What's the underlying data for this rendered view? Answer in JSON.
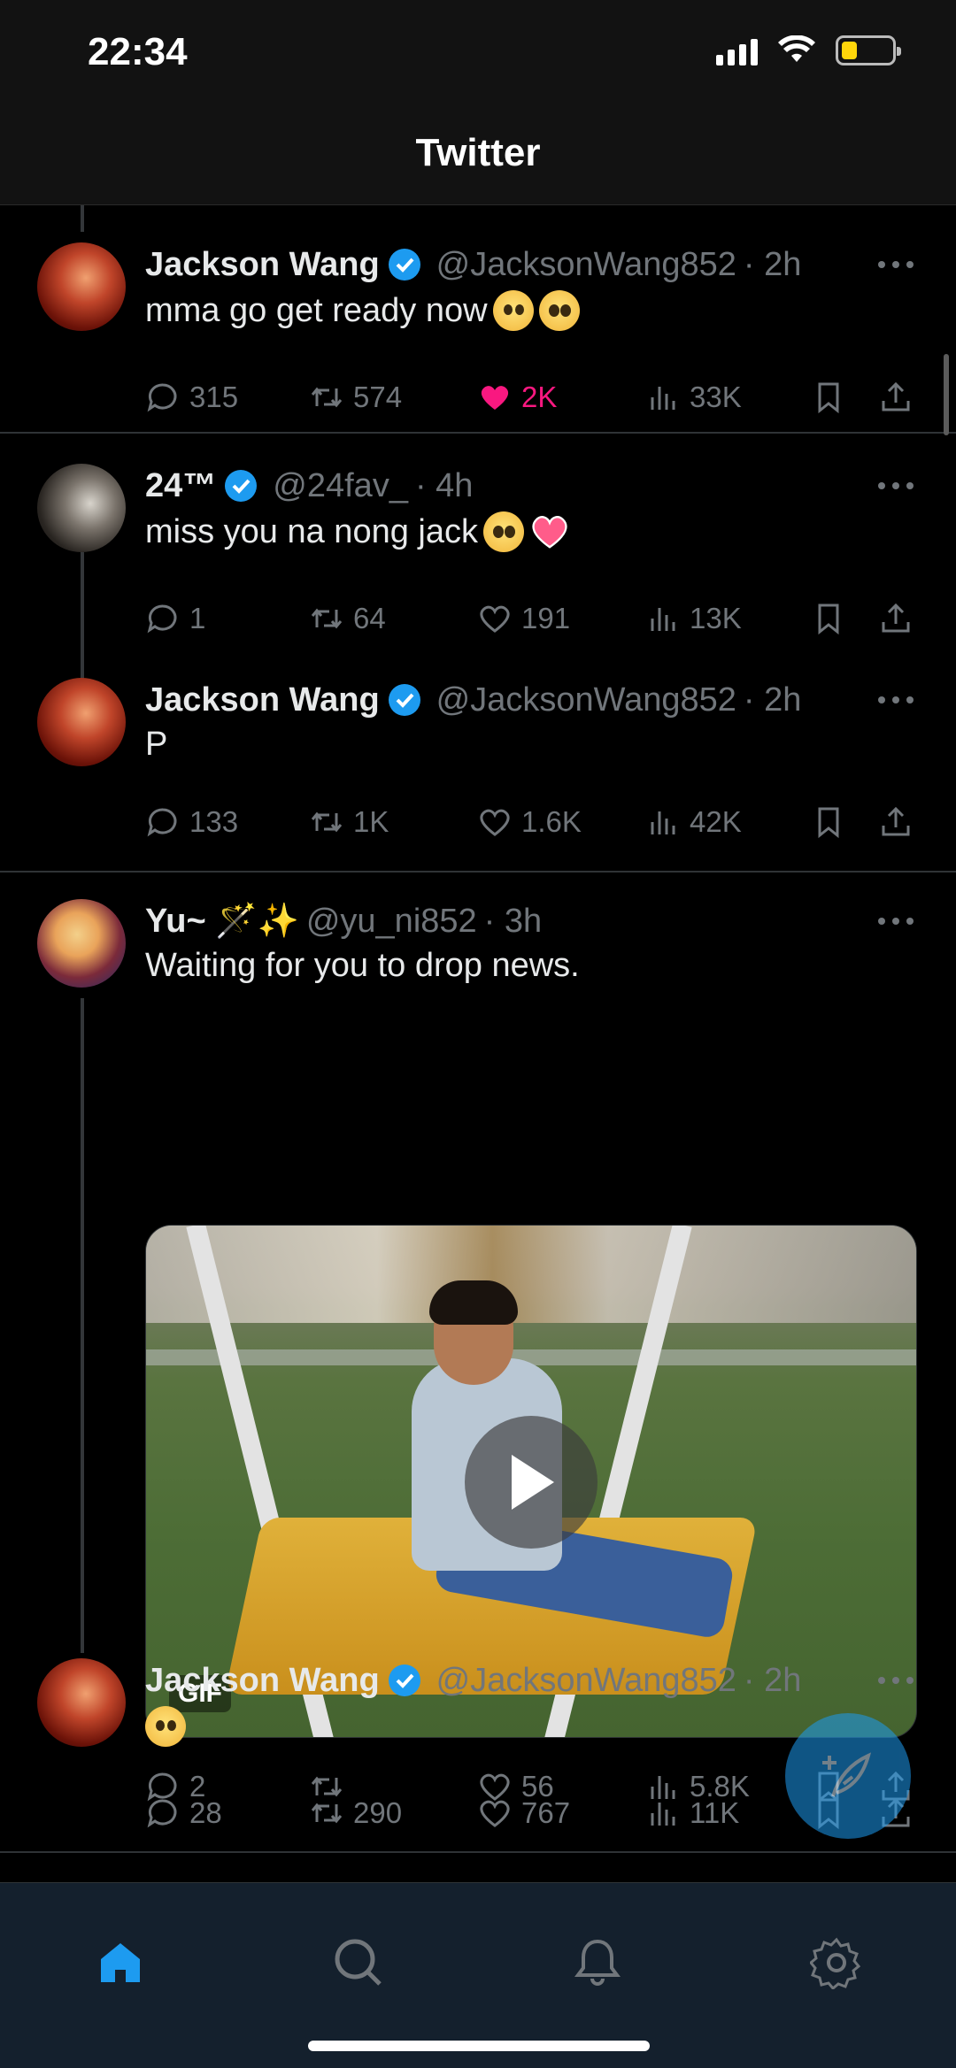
{
  "status_bar": {
    "time": "22:34"
  },
  "header": {
    "title": "Twitter"
  },
  "tweets": [
    {
      "name": "Jackson Wang",
      "handle": "@JacksonWang852",
      "time": "· 2h",
      "text": "mma go get ready now",
      "emojis": [
        "tear-smile-emoji",
        "pleading-emoji"
      ],
      "replies": "315",
      "retweets": "574",
      "likes": "2K",
      "views": "33K",
      "liked": true
    },
    {
      "name": "24™",
      "handle": "@24fav_",
      "time": "· 4h",
      "text": "miss you na nong jack",
      "emojis": [
        "pleading-emoji",
        "heart-emoji"
      ],
      "replies": "1",
      "retweets": "64",
      "likes": "191",
      "views": "13K",
      "liked": false
    },
    {
      "name": "Jackson Wang",
      "handle": "@JacksonWang852",
      "time": "· 2h",
      "text": "P",
      "emojis": [],
      "replies": "133",
      "retweets": "1K",
      "likes": "1.6K",
      "views": "42K",
      "liked": false
    },
    {
      "name": "Yu~ 🪄✨",
      "handle": "@yu_ni852",
      "time": "· 3h",
      "text": "Waiting for you to drop news.",
      "emojis": [],
      "media_badge": "GIF",
      "replies": "2",
      "retweets": "",
      "likes": "56",
      "views": "5.8K",
      "liked": false
    },
    {
      "name": "Jackson Wang",
      "handle": "@JacksonWang852",
      "time": "· 2h",
      "text": "",
      "emojis": [
        "shushing-emoji"
      ],
      "replies": "28",
      "retweets": "290",
      "likes": "767",
      "views": "11K",
      "liked": false
    }
  ],
  "colors": {
    "accent": "#1d9bf0",
    "like": "#f91880",
    "muted": "#71767b",
    "nav_bg": "#14202d"
  },
  "bottom_nav": [
    "home-icon",
    "search-icon",
    "bell-icon",
    "gear-icon"
  ]
}
